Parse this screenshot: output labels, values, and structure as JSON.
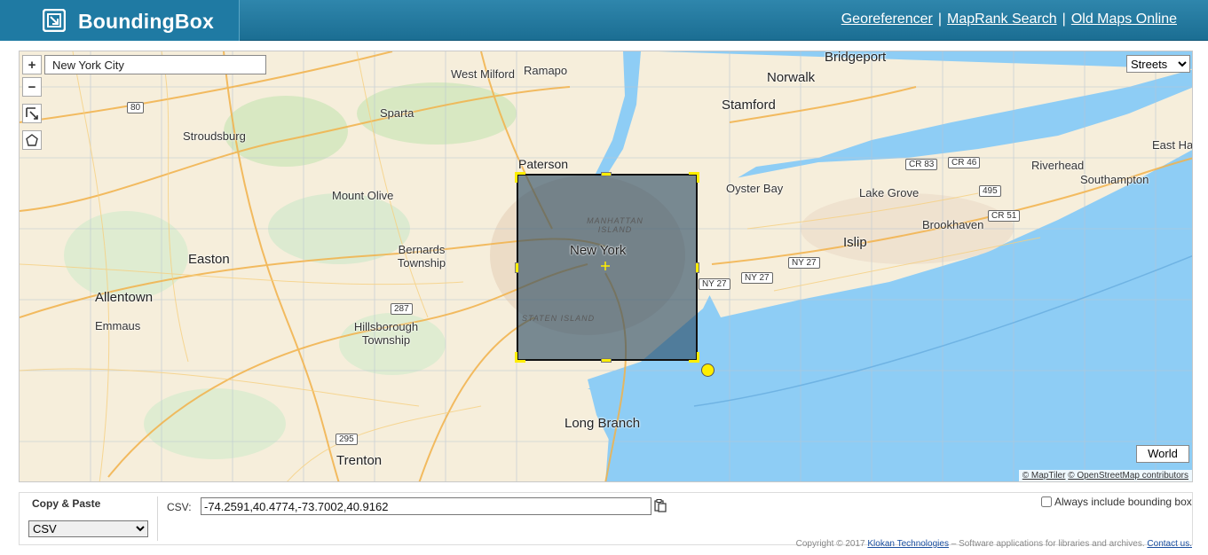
{
  "header": {
    "brand": "BoundingBox",
    "links": [
      {
        "label": "Georeferencer"
      },
      {
        "label": "MapRank Search"
      },
      {
        "label": "Old Maps Online"
      }
    ],
    "separator": "|"
  },
  "map": {
    "search_value": "New York City",
    "zoom_in": "+",
    "zoom_out": "−",
    "layer_options": [
      "Streets"
    ],
    "layer_selected": "Streets",
    "world_button": "World",
    "attribution": {
      "maptiler": "© MapTiler",
      "osm": "© OpenStreetMap contributors"
    },
    "places": [
      "Bridgeport",
      "West Milford",
      "Ramapo",
      "Norwalk",
      "Stamford",
      "Sparta",
      "Stroudsburg",
      "Paterson",
      "Oyster Bay",
      "Riverhead",
      "East Har",
      "Southampton",
      "Lake Grove",
      "Mount Olive",
      "Brookhaven",
      "Bernards Township",
      "New York",
      "Islip",
      "Easton",
      "Allentown",
      "Emmaus",
      "Hillsborough Township",
      "Long Branch",
      "Trenton",
      "MANHATTAN ISLAND",
      "STATEN ISLAND"
    ],
    "shields": [
      "80",
      "CR 83",
      "CR 46",
      "495",
      "CR 51",
      "NY 27",
      "NY 27",
      "NY 27",
      "287",
      "295"
    ],
    "colors": {
      "land": "#f6eedb",
      "water": "#8ecdf5",
      "bbox_fill": "#2a4a64",
      "handle": "#ffee00"
    }
  },
  "panel": {
    "copy_label": "Copy & Paste",
    "format_options": [
      "CSV"
    ],
    "format_selected": "CSV",
    "csv_label": "CSV:",
    "csv_value": "-74.2591,40.4774,-73.7002,40.9162",
    "always_label": "Always include bounding box"
  },
  "footer": {
    "prefix": "Copyright © 2017",
    "company": "Klokan Technologies",
    "middle": "– Software applications for libraries and archives.",
    "contact": "Contact us."
  }
}
